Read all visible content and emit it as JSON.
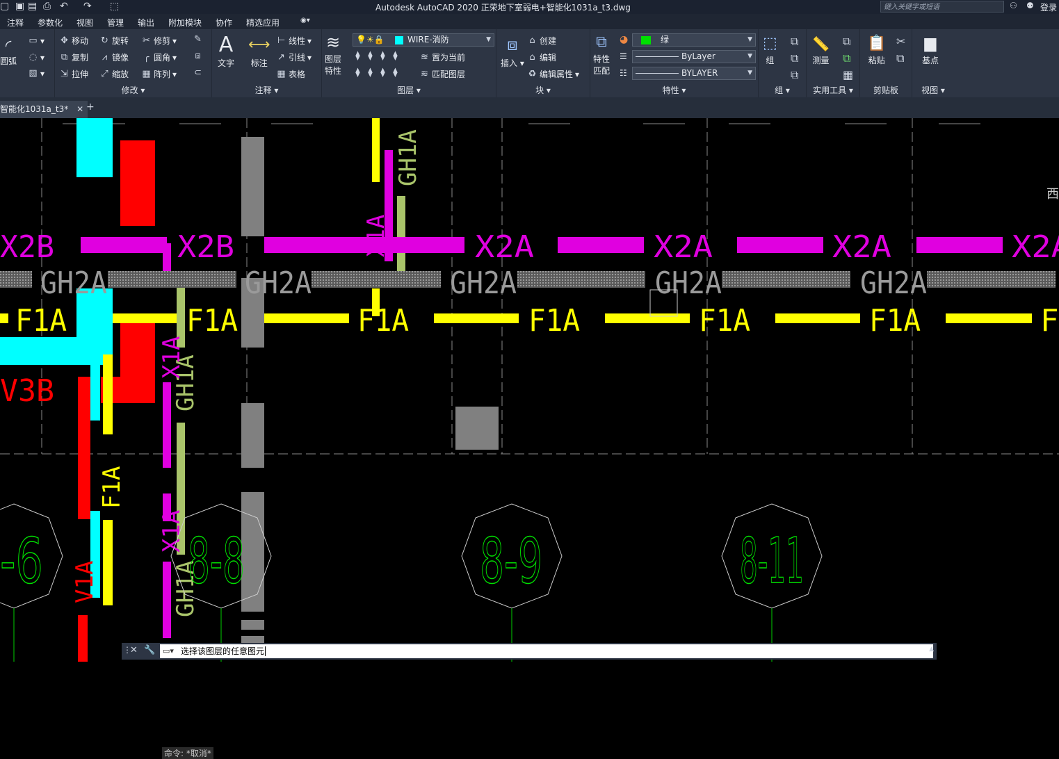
{
  "title": "Autodesk AutoCAD 2020    正荣地下室弱电+智能化1031a_t3.dwg",
  "search_placeholder": "键入关键字或短语",
  "login": "登录",
  "ribbon_tabs": [
    "注释",
    "参数化",
    "视图",
    "管理",
    "输出",
    "附加模块",
    "协作",
    "精选应用"
  ],
  "panels": {
    "draw": {
      "arc": "圆弧"
    },
    "modify": {
      "label": "修改",
      "move": "移动",
      "rotate": "旋转",
      "trim": "修剪",
      "copy": "复制",
      "mirror": "镜像",
      "fillet": "圆角",
      "stretch": "拉伸",
      "scale": "缩放",
      "array": "阵列"
    },
    "annotation": {
      "label": "注释",
      "text": "文字",
      "dimension": "标注",
      "linear": "线性",
      "leader": "引线",
      "table": "表格"
    },
    "layers": {
      "label": "图层",
      "layer_props_1": "图层",
      "layer_props_2": "特性",
      "current_layer": "WIRE-消防",
      "set_current": "置为当前",
      "match_layer": "匹配图层"
    },
    "block": {
      "label": "块",
      "insert": "插入",
      "create": "创建",
      "edit": "编辑",
      "edit_attr": "编辑属性"
    },
    "properties": {
      "label": "特性",
      "match_1": "特性",
      "match_2": "匹配",
      "color": "绿",
      "linetype": "ByLayer",
      "lineweight": "BYLAYER"
    },
    "groups": {
      "label": "组",
      "group": "组"
    },
    "utilities": {
      "label": "实用工具",
      "measure": "测量"
    },
    "clipboard": {
      "label": "剪贴板",
      "paste": "粘贴"
    },
    "view": {
      "label": "视图",
      "basepoint": "基点"
    }
  },
  "doc_tab": "智能化1031a_t3*",
  "canvas_labels": {
    "x2b": "X2B",
    "x2a": "X2A",
    "gh2a": "GH2A",
    "f1a": "F1A",
    "v3b": "V3B",
    "gh1a": "GH1A",
    "x1a": "X1A",
    "v1a": "V1A",
    "f1a_v": "F1A",
    "east": "西",
    "circle_1": "-6",
    "circle_2": "8-8",
    "circle_3": "8-9",
    "circle_4": "8-11"
  },
  "command_history": "命令: *取消*",
  "command_prompt": "选择该图层的任意图元",
  "colors": {
    "magenta": "#e000e0",
    "yellow": "#ffff00",
    "cyan": "#00ffff",
    "red": "#ff0000",
    "gray": "#808080",
    "olive": "#a9c46a",
    "green": "#00d000"
  }
}
